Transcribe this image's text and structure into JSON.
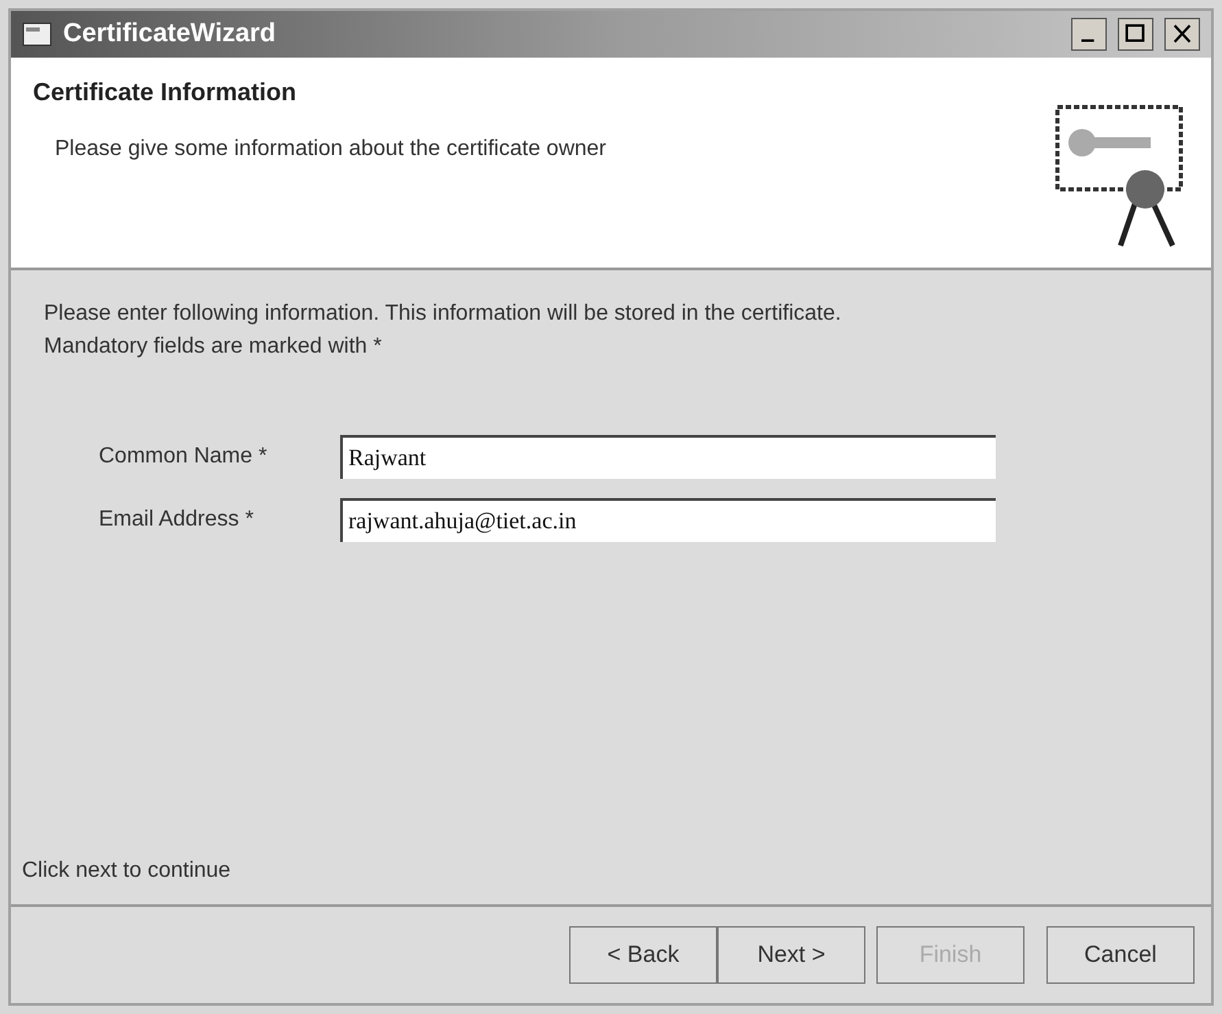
{
  "window": {
    "title": "CertificateWizard"
  },
  "header": {
    "title": "Certificate Information",
    "subtitle": "Please give some information about the certificate owner"
  },
  "intro": {
    "line_1": "Please enter following information. This information will be stored in the certificate.",
    "line_2": "Mandatory fields are marked with *"
  },
  "fields": [
    {
      "label": "Common Name *",
      "value": "Rajwant"
    },
    {
      "label": "Email Address *",
      "value": "rajwant.ahuja@tiet.ac.in"
    }
  ],
  "hint": "Click next to continue",
  "buttons": [
    {
      "label": "< Back",
      "disabled": false
    },
    {
      "label": "Next >",
      "disabled": false
    },
    {
      "label": "Finish",
      "disabled": true
    },
    {
      "label": "Cancel",
      "disabled": false
    }
  ]
}
